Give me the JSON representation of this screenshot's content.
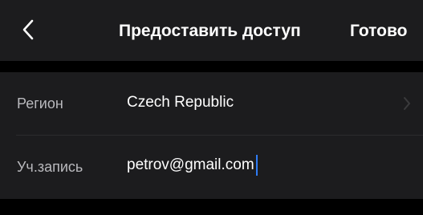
{
  "nav": {
    "back_icon": "chevron-left-icon",
    "title": "Предоставить доступ",
    "done_label": "Готово"
  },
  "form": {
    "region": {
      "label": "Регион",
      "value": "Czech Republic",
      "disclosure_icon": "chevron-right-icon"
    },
    "account": {
      "label": "Уч.запись",
      "value": "petrov@gmail.com"
    }
  },
  "colors": {
    "background": "#000000",
    "surface": "#1c1c1e",
    "label": "#b9b9bd",
    "text": "#ffffff",
    "caret": "#2f7cf6"
  }
}
